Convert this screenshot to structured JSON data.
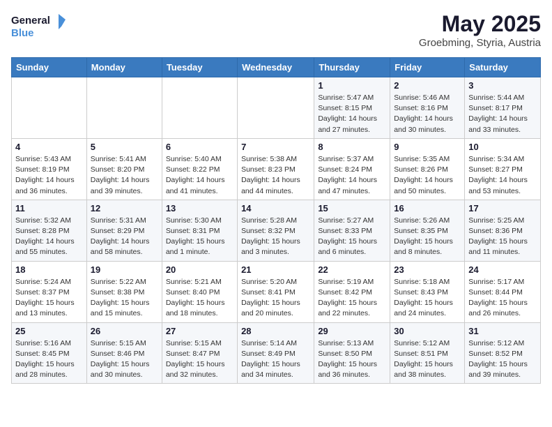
{
  "header": {
    "logo_line1": "General",
    "logo_line2": "Blue",
    "month": "May 2025",
    "location": "Groebming, Styria, Austria"
  },
  "weekdays": [
    "Sunday",
    "Monday",
    "Tuesday",
    "Wednesday",
    "Thursday",
    "Friday",
    "Saturday"
  ],
  "weeks": [
    [
      {
        "day": "",
        "info": ""
      },
      {
        "day": "",
        "info": ""
      },
      {
        "day": "",
        "info": ""
      },
      {
        "day": "",
        "info": ""
      },
      {
        "day": "1",
        "info": "Sunrise: 5:47 AM\nSunset: 8:15 PM\nDaylight: 14 hours\nand 27 minutes."
      },
      {
        "day": "2",
        "info": "Sunrise: 5:46 AM\nSunset: 8:16 PM\nDaylight: 14 hours\nand 30 minutes."
      },
      {
        "day": "3",
        "info": "Sunrise: 5:44 AM\nSunset: 8:17 PM\nDaylight: 14 hours\nand 33 minutes."
      }
    ],
    [
      {
        "day": "4",
        "info": "Sunrise: 5:43 AM\nSunset: 8:19 PM\nDaylight: 14 hours\nand 36 minutes."
      },
      {
        "day": "5",
        "info": "Sunrise: 5:41 AM\nSunset: 8:20 PM\nDaylight: 14 hours\nand 39 minutes."
      },
      {
        "day": "6",
        "info": "Sunrise: 5:40 AM\nSunset: 8:22 PM\nDaylight: 14 hours\nand 41 minutes."
      },
      {
        "day": "7",
        "info": "Sunrise: 5:38 AM\nSunset: 8:23 PM\nDaylight: 14 hours\nand 44 minutes."
      },
      {
        "day": "8",
        "info": "Sunrise: 5:37 AM\nSunset: 8:24 PM\nDaylight: 14 hours\nand 47 minutes."
      },
      {
        "day": "9",
        "info": "Sunrise: 5:35 AM\nSunset: 8:26 PM\nDaylight: 14 hours\nand 50 minutes."
      },
      {
        "day": "10",
        "info": "Sunrise: 5:34 AM\nSunset: 8:27 PM\nDaylight: 14 hours\nand 53 minutes."
      }
    ],
    [
      {
        "day": "11",
        "info": "Sunrise: 5:32 AM\nSunset: 8:28 PM\nDaylight: 14 hours\nand 55 minutes."
      },
      {
        "day": "12",
        "info": "Sunrise: 5:31 AM\nSunset: 8:29 PM\nDaylight: 14 hours\nand 58 minutes."
      },
      {
        "day": "13",
        "info": "Sunrise: 5:30 AM\nSunset: 8:31 PM\nDaylight: 15 hours\nand 1 minute."
      },
      {
        "day": "14",
        "info": "Sunrise: 5:28 AM\nSunset: 8:32 PM\nDaylight: 15 hours\nand 3 minutes."
      },
      {
        "day": "15",
        "info": "Sunrise: 5:27 AM\nSunset: 8:33 PM\nDaylight: 15 hours\nand 6 minutes."
      },
      {
        "day": "16",
        "info": "Sunrise: 5:26 AM\nSunset: 8:35 PM\nDaylight: 15 hours\nand 8 minutes."
      },
      {
        "day": "17",
        "info": "Sunrise: 5:25 AM\nSunset: 8:36 PM\nDaylight: 15 hours\nand 11 minutes."
      }
    ],
    [
      {
        "day": "18",
        "info": "Sunrise: 5:24 AM\nSunset: 8:37 PM\nDaylight: 15 hours\nand 13 minutes."
      },
      {
        "day": "19",
        "info": "Sunrise: 5:22 AM\nSunset: 8:38 PM\nDaylight: 15 hours\nand 15 minutes."
      },
      {
        "day": "20",
        "info": "Sunrise: 5:21 AM\nSunset: 8:40 PM\nDaylight: 15 hours\nand 18 minutes."
      },
      {
        "day": "21",
        "info": "Sunrise: 5:20 AM\nSunset: 8:41 PM\nDaylight: 15 hours\nand 20 minutes."
      },
      {
        "day": "22",
        "info": "Sunrise: 5:19 AM\nSunset: 8:42 PM\nDaylight: 15 hours\nand 22 minutes."
      },
      {
        "day": "23",
        "info": "Sunrise: 5:18 AM\nSunset: 8:43 PM\nDaylight: 15 hours\nand 24 minutes."
      },
      {
        "day": "24",
        "info": "Sunrise: 5:17 AM\nSunset: 8:44 PM\nDaylight: 15 hours\nand 26 minutes."
      }
    ],
    [
      {
        "day": "25",
        "info": "Sunrise: 5:16 AM\nSunset: 8:45 PM\nDaylight: 15 hours\nand 28 minutes."
      },
      {
        "day": "26",
        "info": "Sunrise: 5:15 AM\nSunset: 8:46 PM\nDaylight: 15 hours\nand 30 minutes."
      },
      {
        "day": "27",
        "info": "Sunrise: 5:15 AM\nSunset: 8:47 PM\nDaylight: 15 hours\nand 32 minutes."
      },
      {
        "day": "28",
        "info": "Sunrise: 5:14 AM\nSunset: 8:49 PM\nDaylight: 15 hours\nand 34 minutes."
      },
      {
        "day": "29",
        "info": "Sunrise: 5:13 AM\nSunset: 8:50 PM\nDaylight: 15 hours\nand 36 minutes."
      },
      {
        "day": "30",
        "info": "Sunrise: 5:12 AM\nSunset: 8:51 PM\nDaylight: 15 hours\nand 38 minutes."
      },
      {
        "day": "31",
        "info": "Sunrise: 5:12 AM\nSunset: 8:52 PM\nDaylight: 15 hours\nand 39 minutes."
      }
    ]
  ]
}
